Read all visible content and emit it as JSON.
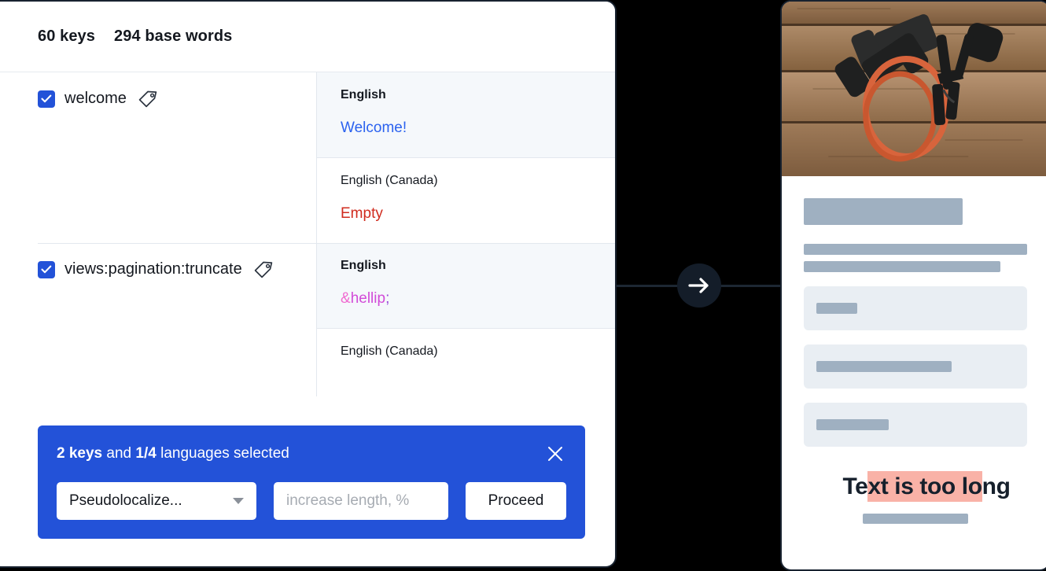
{
  "left_panel": {
    "header": {
      "keys_count": "60 keys",
      "base_words_count": "294 base words"
    },
    "rows": [
      {
        "key_name": "welcome",
        "checked": true,
        "tag_icon": "tag-icon",
        "languages": [
          {
            "name": "English",
            "value": "Welcome!",
            "state": "source",
            "highlight": true
          },
          {
            "name": "English (Canada)",
            "value": "Empty",
            "state": "empty",
            "highlight": false
          }
        ]
      },
      {
        "key_name": "views:pagination:truncate",
        "checked": true,
        "tag_icon": "tag-icon",
        "languages": [
          {
            "name": "English",
            "value": "&hellip;",
            "value_amp": "&",
            "value_word": "hellip",
            "value_semi": ";",
            "state": "code",
            "highlight": true
          },
          {
            "name": "English (Canada)",
            "value": "",
            "state": "empty",
            "highlight": false
          }
        ]
      }
    ],
    "action_bar": {
      "summary_keys": "2 keys",
      "summary_mid": " and ",
      "summary_langs": "1/4",
      "summary_tail": " languages selected",
      "close_icon": "close-icon",
      "select_value": "Pseudolocalize...",
      "select_caret": "chevron-down-icon",
      "input_placeholder": "increase length, %",
      "input_value": "",
      "proceed_label": "Proceed"
    }
  },
  "connector": {
    "arrow_icon": "arrow-right-icon"
  },
  "right_panel": {
    "hero_alt": "dumbbells-and-resistance-band-on-wood",
    "overflow_text_prefix": "Te",
    "overflow_text_highlight": "xt is too lo",
    "overflow_text_suffix": "ng",
    "overflow_text_full": "Text is too long"
  },
  "colors": {
    "accent_blue": "#2352d8",
    "link_blue": "#2b62ef",
    "error_red": "#d02b1e",
    "code_magenta": "#d24bd8",
    "highlight_salmon": "#f9b2a7",
    "skeleton_gray": "#9fb0c1",
    "panel_gray": "#e9eef3",
    "row_highlight": "#f5f8fb",
    "dark_navy": "#18222f",
    "background": "#000000"
  }
}
